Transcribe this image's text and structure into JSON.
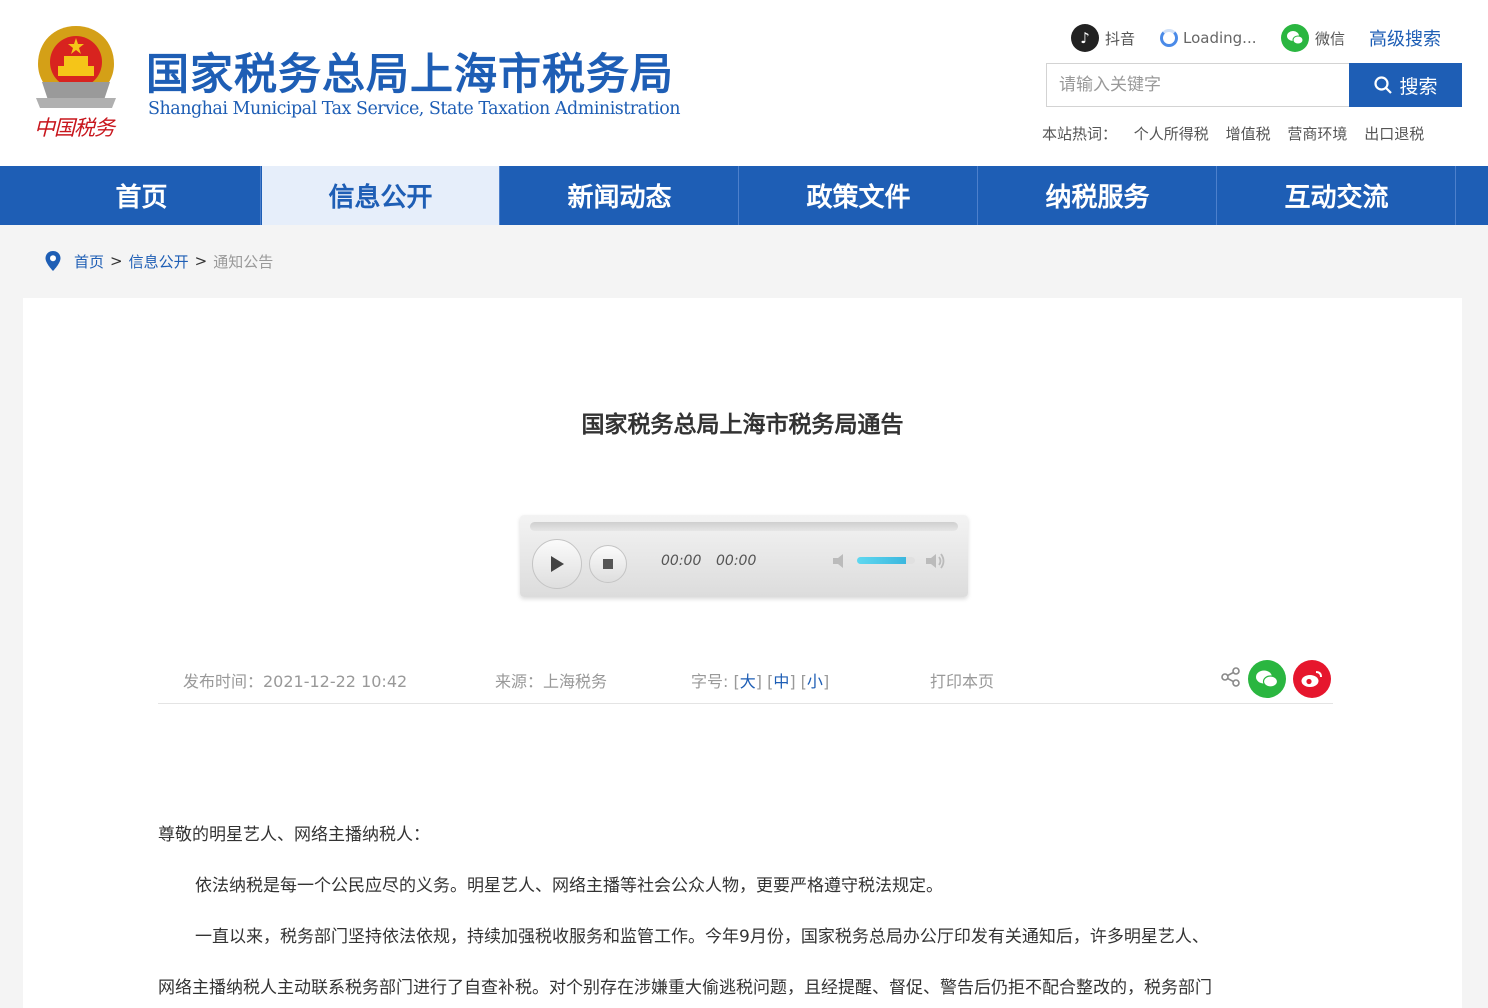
{
  "header": {
    "title_cn": "国家税务总局上海市税务局",
    "title_en": "Shanghai Municipal Tax Service, State Taxation Administration",
    "logo_text": "中国税务",
    "social": {
      "douyin_label": "抖音",
      "loading_label": "Loading...",
      "wechat_label": "微信"
    },
    "advanced_search": "高级搜索",
    "search": {
      "placeholder": "请输入关键字",
      "button_label": "搜索"
    },
    "hotwords": {
      "label": "本站热词：",
      "items": [
        "个人所得税",
        "增值税",
        "营商环境",
        "出口退税"
      ]
    }
  },
  "nav": {
    "items": [
      {
        "label": "首页"
      },
      {
        "label": "信息公开"
      },
      {
        "label": "新闻动态"
      },
      {
        "label": "政策文件"
      },
      {
        "label": "纳税服务"
      },
      {
        "label": "互动交流"
      }
    ],
    "active": "信息公开"
  },
  "breadcrumb": {
    "home": "首页",
    "section": "信息公开",
    "current": "通知公告",
    "separator": ">"
  },
  "article": {
    "title": "国家税务总局上海市税务局通告",
    "player": {
      "current_time": "00:00",
      "duration": "00:00",
      "volume_level": 0.85
    },
    "meta": {
      "publish_time": "发布时间：2021-12-22 10:42",
      "source": "来源：上海税务",
      "font_size_label": "字号:",
      "font_large": "大",
      "font_medium": "中",
      "font_small": "小",
      "print": "打印本页"
    },
    "body": {
      "salutation": "尊敬的明星艺人、网络主播纳税人：",
      "paragraph1": "依法纳税是每一个公民应尽的义务。明星艺人、网络主播等社会公众人物，更要严格遵守税法规定。",
      "paragraph2_line1": "一直以来，税务部门坚持依法依规，持续加强税收服务和监管工作。今年9月份，国家税务总局办公厅印发有关通知后，许多明星艺人、",
      "paragraph2_line2": "网络主播纳税人主动联系税务部门进行了自查补税。对个别存在涉嫌重大偷逃税问题，且经提醒、督促、警告后仍拒不配合整改的，税务部门"
    }
  },
  "colors": {
    "brand_blue": "#1e5eb5",
    "wechat_green": "#2ab640",
    "weibo_red": "#e6162d",
    "emblem_red": "#c8161d"
  }
}
